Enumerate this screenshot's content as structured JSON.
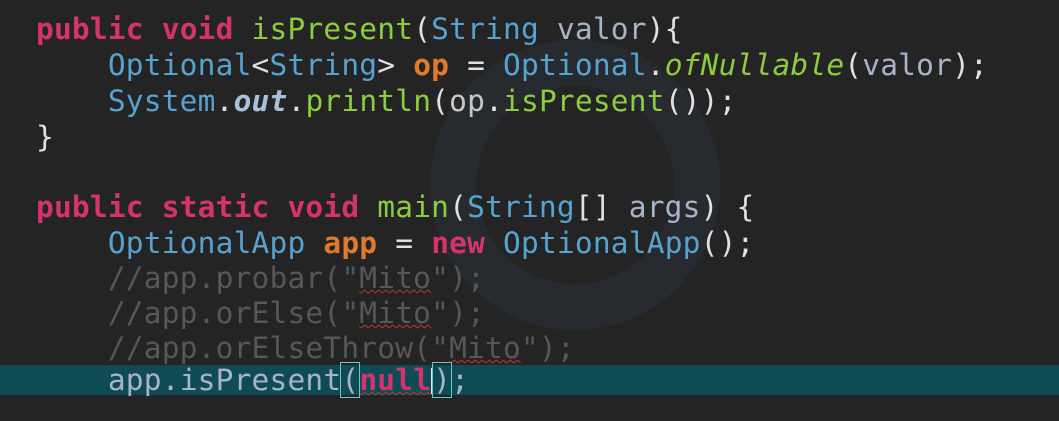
{
  "code": {
    "l1": {
      "kw1": "public",
      "kw2": "void",
      "meth": "isPresent",
      "p1": "(",
      "typ": "String",
      "var": "valor",
      "p2": "){"
    },
    "l2": {
      "typ1": "Optional",
      "p1": "<",
      "typ2": "String",
      "p2": ">",
      "loc": "op",
      "p3": "=",
      "typ3": "Optional",
      "p4": ".",
      "smth": "ofNullable",
      "p5": "(",
      "var": "valor",
      "p6": ");"
    },
    "l3": {
      "typ": "System",
      "p1": ".",
      "sfld": "out",
      "p2": ".",
      "meth": "println",
      "p3": "(",
      "id": "op",
      "p4": ".",
      "meth2": "isPresent",
      "p5": "());"
    },
    "l4": {
      "p1": "}"
    },
    "l5": {
      "kw1": "public",
      "kw2": "static",
      "kw3": "void",
      "meth": "main",
      "p1": "(",
      "typ": "String",
      "p2": "[]",
      "var": "args",
      "p3": ") {"
    },
    "l6": {
      "typ1": "OptionalApp",
      "loc": "app",
      "p1": "=",
      "kw": "new",
      "typ2": "OptionalApp",
      "p2": "();"
    },
    "l7": {
      "pre": "//app.probar(\"",
      "squig": "Mito",
      "post": "\");"
    },
    "l8": {
      "pre": "//app.orElse(\"",
      "squig": "Mito",
      "post": "\");"
    },
    "l9": {
      "pre": "//app.orElseThrow(\"",
      "squig": "Mito",
      "post": "\");"
    },
    "l10": {
      "id": "app",
      "p1": ".",
      "meth": "isPresent",
      "p2": "(",
      "null": "null",
      "p3": ")",
      "p4": ";"
    }
  }
}
